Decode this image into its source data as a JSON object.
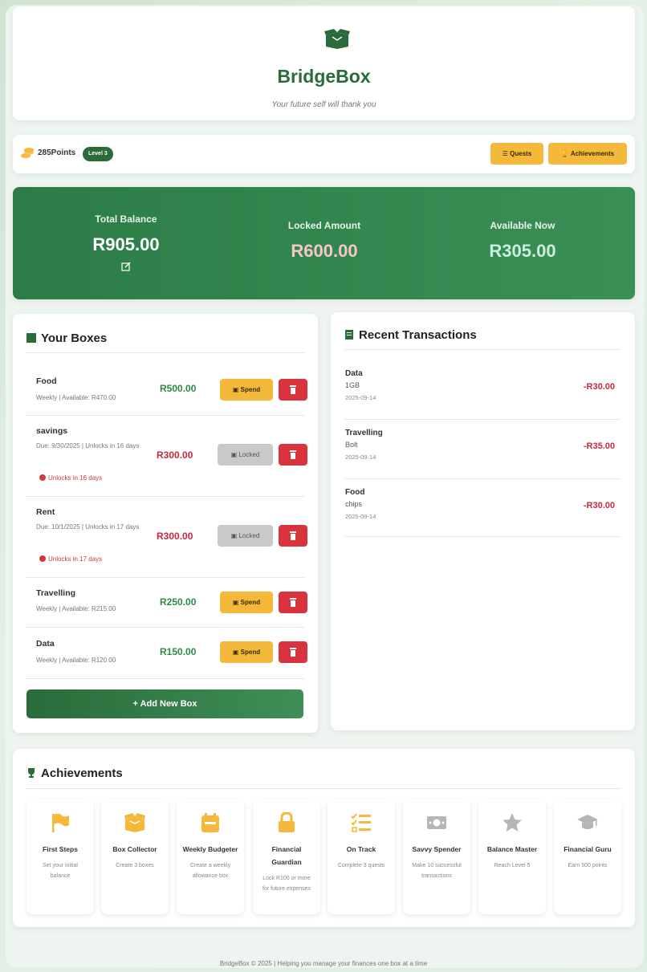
{
  "header": {
    "title": "BridgeBox",
    "tagline": "Your future self will thank you"
  },
  "stats": {
    "points": "285Points",
    "level": "Level 3",
    "quests_label": "Quests",
    "achievements_label": "Achievements"
  },
  "balance": {
    "total_label": "Total Balance",
    "total_value": "R905.00",
    "locked_label": "Locked Amount",
    "locked_value": "R600.00",
    "available_label": "Available Now",
    "available_value": "R305.00"
  },
  "boxes": {
    "title": "Your Boxes",
    "items": [
      {
        "name": "Food",
        "meta": "Weekly | Available: R470.00",
        "amount": "R500.00",
        "action": "Spend"
      },
      {
        "name": "savings",
        "meta": "Due: 9/30/2025 | Unlocks in 16 days",
        "warning": "Unlocks in 16 days",
        "amount": "R300.00",
        "action": "Locked"
      },
      {
        "name": "Rent",
        "meta": "Due: 10/1/2025 | Unlocks in 17 days",
        "warning": "Unlocks in 17 days",
        "amount": "R300.00",
        "action": "Locked"
      },
      {
        "name": "Travelling",
        "meta": "Weekly | Available: R215.00",
        "amount": "R250.00",
        "action": "Spend"
      },
      {
        "name": "Data",
        "meta": "Weekly | Available: R120.00",
        "amount": "R150.00",
        "action": "Spend"
      }
    ],
    "add_label": "Add New Box"
  },
  "transactions": {
    "title": "Recent Transactions",
    "items": [
      {
        "title": "Data",
        "desc": "1GB",
        "date": "2025-09-14",
        "amount": "-R30.00"
      },
      {
        "title": "Travelling",
        "desc": "Bolt",
        "date": "2025-09-14",
        "amount": "-R35.00"
      },
      {
        "title": "Food",
        "desc": "chips",
        "date": "2025-09-14",
        "amount": "-R30.00"
      }
    ]
  },
  "achievements": {
    "title": "Achievements",
    "items": [
      {
        "name": "First Steps",
        "desc": "Set your initial balance",
        "icon": "flag-icon",
        "color": "#f4b93a"
      },
      {
        "name": "Box Collector",
        "desc": "Create 3 boxes",
        "icon": "box-icon",
        "color": "#f4b93a"
      },
      {
        "name": "Weekly Budgeter",
        "desc": "Create a weekly allowance box",
        "icon": "calendar-icon",
        "color": "#f4b93a"
      },
      {
        "name": "Financial Guardian",
        "desc": "Lock R100 or more for future expenses",
        "icon": "lock-icon",
        "color": "#f4b93a"
      },
      {
        "name": "On Track",
        "desc": "Complete 3 quests",
        "icon": "tasks-icon",
        "color": "#f4b93a"
      },
      {
        "name": "Savvy Spender",
        "desc": "Make 10 successful transactions",
        "icon": "money-icon",
        "color": "#b5b5b5"
      },
      {
        "name": "Balance Master",
        "desc": "Reach Level 5",
        "icon": "star-icon",
        "color": "#b5b5b5"
      },
      {
        "name": "Financial Guru",
        "desc": "Earn 500 points",
        "icon": "graduation-cap-icon",
        "color": "#b5b5b5"
      }
    ]
  },
  "footer": "BridgeBox © 2025 | Helping you manage your finances one box at a time"
}
